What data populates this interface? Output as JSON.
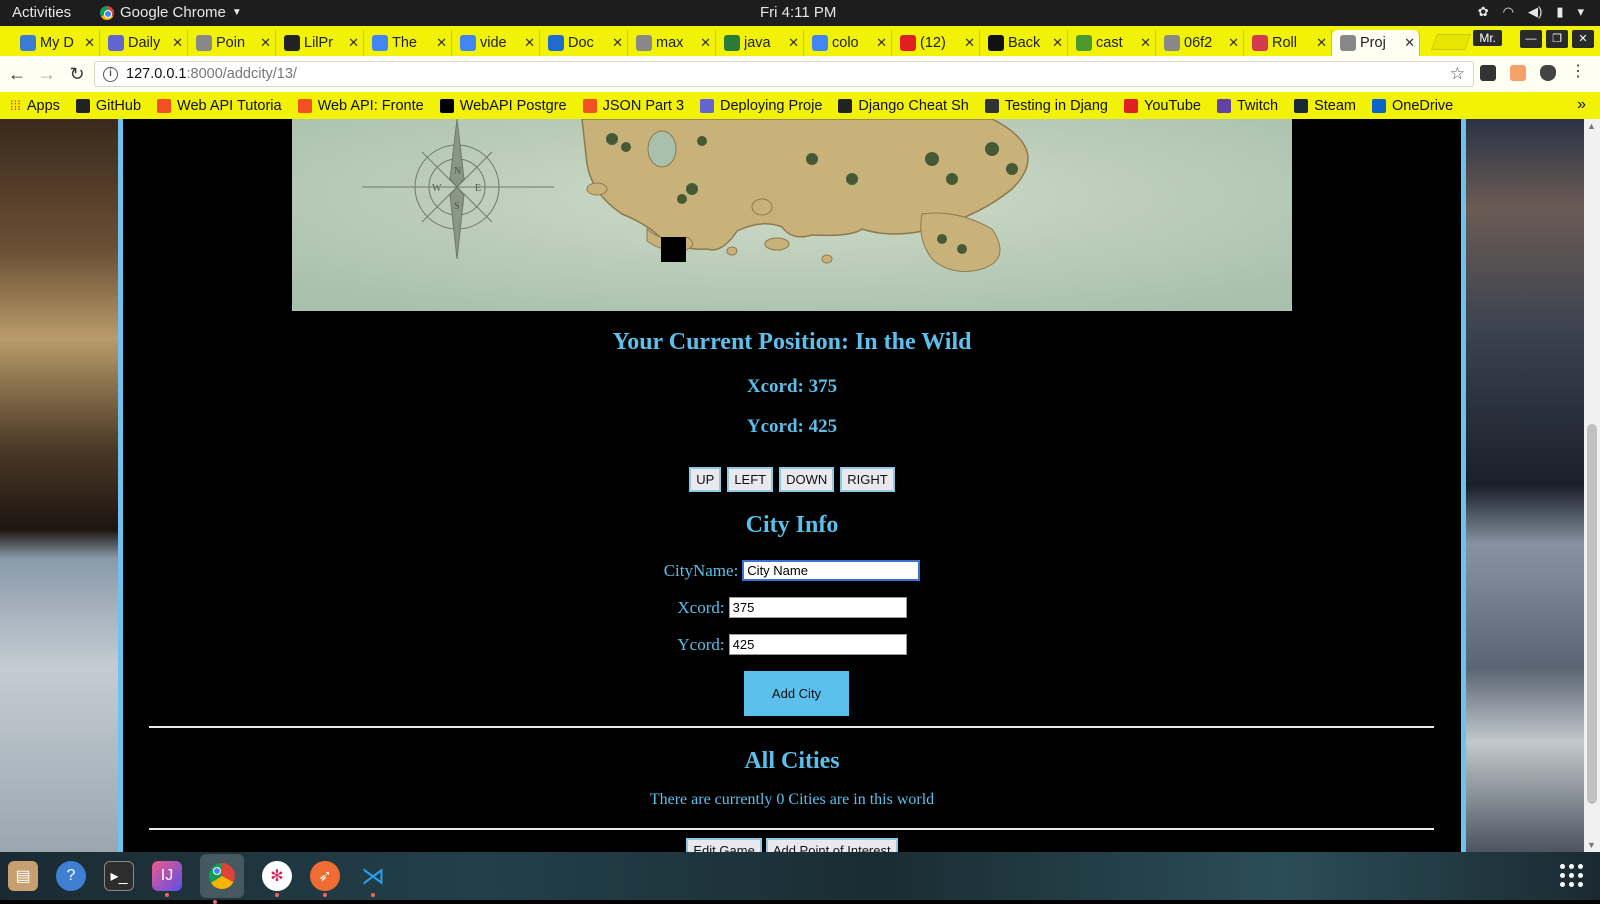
{
  "system_bar": {
    "activities": "Activities",
    "app_name": "Google Chrome",
    "clock": "Fri  4:11 PM"
  },
  "tabs": [
    {
      "label": "My D",
      "color": "#3b7bd6"
    },
    {
      "label": "Daily",
      "color": "#6264d1"
    },
    {
      "label": "Poin",
      "color": "#888888"
    },
    {
      "label": "LilPr",
      "color": "#222222"
    },
    {
      "label": "The",
      "color": "#4285f4"
    },
    {
      "label": "vide",
      "color": "#4285f4"
    },
    {
      "label": "Doc",
      "color": "#1f6bd1"
    },
    {
      "label": "max",
      "color": "#888888"
    },
    {
      "label": "java",
      "color": "#2b7a3a"
    },
    {
      "label": "colo",
      "color": "#4285f4"
    },
    {
      "label": "(12)",
      "color": "#e02020"
    },
    {
      "label": "Back",
      "color": "#111111"
    },
    {
      "label": "cast",
      "color": "#4a9a30"
    },
    {
      "label": "06f2",
      "color": "#888888"
    },
    {
      "label": "Roll",
      "color": "#d23b4e"
    },
    {
      "label": "Proj",
      "color": "#888888",
      "active": true
    }
  ],
  "profile_label": "Mr.",
  "address_bar": {
    "host": "127.0.0.1",
    "path": ":8000/addcity/13/"
  },
  "bookmarks": {
    "apps_label": "Apps",
    "items": [
      {
        "label": "GitHub",
        "color": "#222222"
      },
      {
        "label": "Web API Tutoria",
        "color": "#f25022"
      },
      {
        "label": "Web API: Fronte",
        "color": "#f25022"
      },
      {
        "label": "WebAPI Postgre",
        "color": "#000000"
      },
      {
        "label": "JSON Part 3",
        "color": "#f25022"
      },
      {
        "label": "Deploying Proje",
        "color": "#6264d1"
      },
      {
        "label": "Django Cheat Sh",
        "color": "#222222"
      },
      {
        "label": "Testing in Djang",
        "color": "#333333"
      },
      {
        "label": "YouTube",
        "color": "#e02020"
      },
      {
        "label": "Twitch",
        "color": "#6441a5"
      },
      {
        "label": "Steam",
        "color": "#1b2838"
      },
      {
        "label": "OneDrive",
        "color": "#0a64c9"
      }
    ],
    "more": "»"
  },
  "page": {
    "position_title": "Your Current Position: In the Wild",
    "xcord_display": "Xcord: 375",
    "ycord_display": "Ycord: 425",
    "move_buttons": {
      "up": "UP",
      "left": "LEFT",
      "down": "DOWN",
      "right": "RIGHT"
    },
    "city_info_title": "City Info",
    "form": {
      "cityname_label": "CityName:",
      "cityname_value": "City Name",
      "xcord_label": "Xcord:",
      "xcord_value": "375",
      "ycord_label": "Ycord:",
      "ycord_value": "425",
      "submit_label": "Add City"
    },
    "all_cities_title": "All Cities",
    "cities_count_text": "There are currently 0 Cities are in this world",
    "bottom_buttons": {
      "edit_game": "Edit Game",
      "add_poi": "Add Point of Interest"
    }
  },
  "colors": {
    "accent": "#5bc0eb",
    "chrome_theme": "#f2f207"
  }
}
